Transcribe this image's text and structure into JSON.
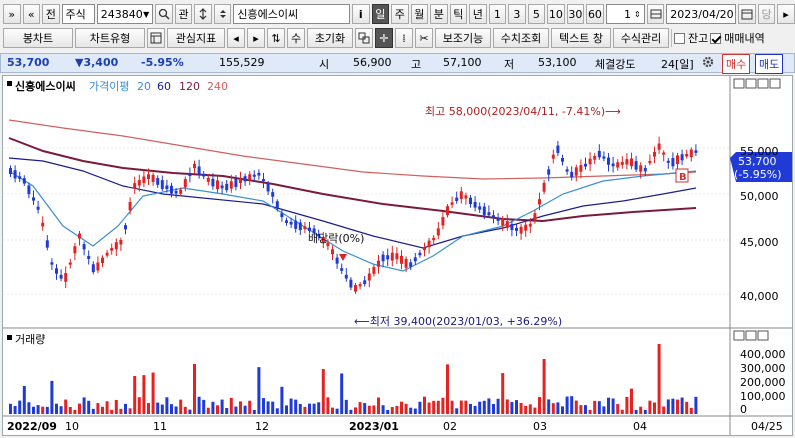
{
  "toolbar1": {
    "nav_prev": "»",
    "nav_up": "«",
    "jeon_label": "전",
    "asset_type": "주식",
    "code": "243840",
    "gwan_label": "관",
    "stock_name": "신흥에스이씨",
    "info_label": "i",
    "periods": [
      "일",
      "주",
      "월",
      "분",
      "틱",
      "년"
    ],
    "intervals": [
      "1",
      "3",
      "5",
      "10",
      "30",
      "60"
    ],
    "count": "1",
    "date": "2023/04/20",
    "dang_label": "당"
  },
  "toolbar2": {
    "bongchart": "봉차트",
    "chart_type": "차트유형",
    "indicator": "관심지표",
    "su_label": "수",
    "reset": "초기화",
    "assist": "보조기능",
    "numeric": "수치조회",
    "text_window": "텍스트 창",
    "formula": "수식관리",
    "balance": "잔고",
    "trade_history": "매매내역"
  },
  "quote": {
    "price": "53,700",
    "change": "▼3,400",
    "rate": "-5.95%",
    "volume": "155,529",
    "open_label": "시",
    "open": "56,900",
    "high_label": "고",
    "high": "57,100",
    "low_label": "저",
    "low": "53,100",
    "strength_label": "체결강도",
    "strength": "24[일]",
    "buy_label": "매수",
    "sell_label": "매도"
  },
  "price_panel": {
    "title": "신흥에스이씨",
    "legend_price_ma": "가격이평",
    "ma": [
      "20",
      "60",
      "120",
      "240"
    ],
    "ma_colors": [
      "#3a8fd6",
      "#1e1e8c",
      "#7b1a3a",
      "#d06060"
    ],
    "y_ticks": [
      "55,000",
      "50,000",
      "45,000",
      "40,000"
    ],
    "high_annotation": "최고 58,000(2023/04/11, -7.41%)⟶",
    "low_annotation": "⟵최저 39,400(2023/01/03, +36.29%)",
    "dividend": "배당락(0%)",
    "last_price": "53,700",
    "last_rate": "(-5.95%)",
    "marker": "B"
  },
  "volume_panel": {
    "title": "거래량",
    "y_ticks": [
      "400,000",
      "300,000",
      "200,000",
      "100,000",
      "0"
    ]
  },
  "x_axis": {
    "labels": [
      "2022/09",
      "10",
      "11",
      "12",
      "2023/01",
      "02",
      "03",
      "04"
    ],
    "right_label": "04/25"
  },
  "colors": {
    "up": "#e32222",
    "down": "#1f3ad6"
  }
}
